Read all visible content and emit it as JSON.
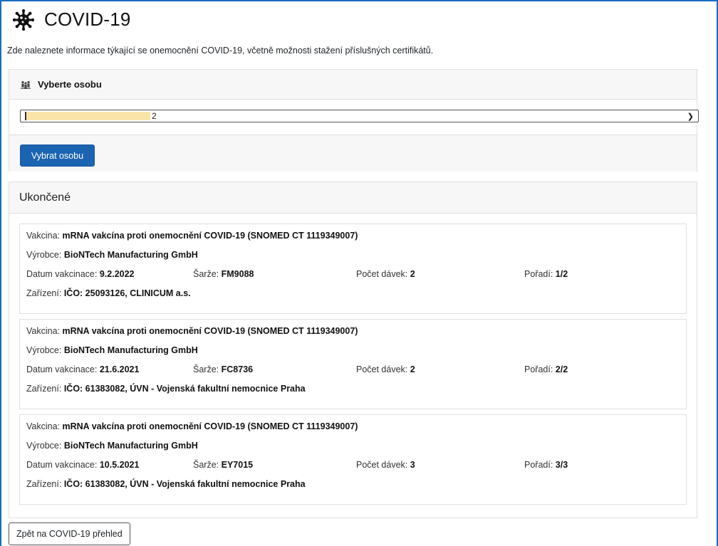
{
  "page": {
    "title": "COVID-19",
    "intro": "Zde naleznete informace týkající se onemocnění COVID-19, včetně možnosti stažení příslušných certifikátů."
  },
  "person": {
    "header": "Vyberte osobu",
    "selected_suffix": "2",
    "button": "Vybrat osobu"
  },
  "completed": {
    "title": "Ukončené",
    "labels": {
      "vaccine": "Vakcina:",
      "maker": "Výrobce:",
      "date": "Datum vakcinace:",
      "batch": "Šarže:",
      "doses": "Počet dávek:",
      "order": "Pořadí:",
      "facility": "Zařízení:"
    },
    "items": [
      {
        "vaccine": "mRNA vakcína proti onemocnění COVID-19 (SNOMED CT 1119349007)",
        "maker": "BioNTech Manufacturing GmbH",
        "date": "9.2.2022",
        "batch": "FM9088",
        "doses": "2",
        "order": "1/2",
        "facility": "IČO: 25093126, CLINICUM a.s."
      },
      {
        "vaccine": "mRNA vakcína proti onemocnění COVID-19 (SNOMED CT 1119349007)",
        "maker": "BioNTech Manufacturing GmbH",
        "date": "21.6.2021",
        "batch": "FC8736",
        "doses": "2",
        "order": "2/2",
        "facility": "IČO: 61383082, ÚVN - Vojenská fakultní nemocnice Praha"
      },
      {
        "vaccine": "mRNA vakcína proti onemocnění COVID-19 (SNOMED CT 1119349007)",
        "maker": "BioNTech Manufacturing GmbH",
        "date": "10.5.2021",
        "batch": "EY7015",
        "doses": "3",
        "order": "3/3",
        "facility": "IČO: 61383082, ÚVN - Vojenská fakultní nemocnice Praha"
      }
    ]
  },
  "back_button": "Zpět na COVID-19 přehled",
  "icons": {
    "title": "virus-icon",
    "person": "people-icon",
    "select": "chevron-down-icon"
  },
  "colors": {
    "accent": "#1b64b1",
    "panel": "#f7f7f7",
    "redaction": "#fbe4a8"
  }
}
